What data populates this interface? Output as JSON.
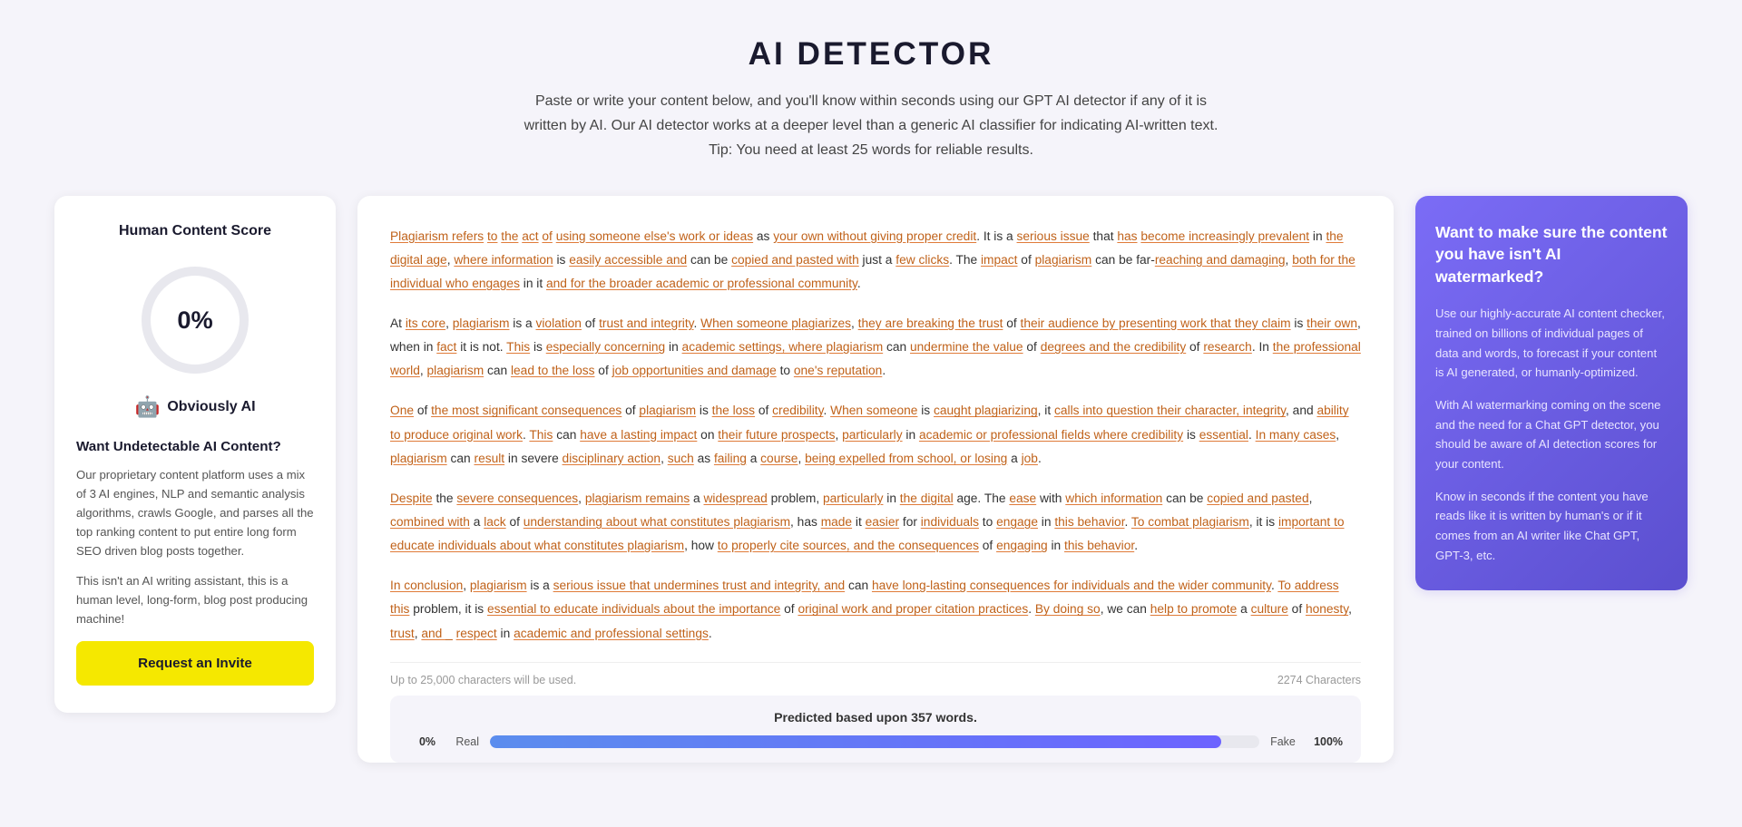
{
  "header": {
    "title": "AI DETECTOR",
    "description": "Paste or write your content below, and you'll know within seconds using our GPT AI detector if any of it is written by AI. Our AI detector works at a deeper level than a generic AI classifier for indicating AI-written text. Tip: You need at least 25 words for reliable results."
  },
  "left_panel": {
    "score_title": "Human Content Score",
    "score_value": "0%",
    "score_label": "Obviously AI",
    "want_title": "Want Undetectable AI Content?",
    "desc1": "Our proprietary content platform uses a mix of 3 AI engines, NLP and semantic analysis algorithms, crawls Google, and parses all the top ranking content to put entire long form SEO driven blog posts together.",
    "desc2": "This isn't an AI writing assistant, this is a human level, long-form, blog post producing machine!",
    "button_label": "Request an Invite"
  },
  "center_panel": {
    "paragraph1": "Plagiarism refers to the act of using someone else's work or ideas as your own without giving proper credit. It is a serious issue that has become increasingly prevalent in the digital age, where information is easily accessible and can be copied and pasted with just a few clicks. The impact of plagiarism can be far-reaching and damaging, both for the individual who engages in it and for the broader academic or professional community.",
    "paragraph2": "At its core, plagiarism is a violation of trust and integrity. When someone plagiarizes, they are breaking the trust of their audience by presenting work that they claim is their own, when in fact it is not. This is especially concerning in academic settings, where plagiarism can undermine the value of degrees and the credibility of research. In the professional world, plagiarism can lead to the loss of job opportunities and damage to one's reputation.",
    "paragraph3": "One of the most significant consequences of plagiarism is the loss of credibility. When someone is caught plagiarizing, it calls into question their character, integrity, and ability to produce original work. This can have a lasting impact on their future prospects, particularly in academic or professional fields where credibility is essential. In many cases, plagiarism can result in severe disciplinary action, such as failing a course, being expelled from school, or losing a job.",
    "paragraph4": "Despite the severe consequences, plagiarism remains a widespread problem, particularly in the digital age. The ease with which information can be copied and pasted, combined with a lack of understanding about what constitutes plagiarism, has made it easier for individuals to engage in this behavior. To combat plagiarism, it is important to educate individuals about what constitutes plagiarism, how to properly cite sources, and the consequences of engaging in this behavior.",
    "paragraph5": "In conclusion, plagiarism is a serious issue that undermines trust and integrity, and can have long-lasting consequences for individuals and the wider community. To address this problem, it is essential to educate individuals about the importance of original work and proper citation practices. By doing so, we can help to promote a culture of honesty, trust, and respect in academic and professional settings.",
    "footer_left": "Up to 25,000 characters will be used.",
    "footer_right": "2274 Characters",
    "prediction_label": "Predicted based upon",
    "prediction_words": "357 words",
    "bar_left_pct": "0%",
    "bar_left_label": "Real",
    "bar_right_pct": "100%",
    "bar_right_label": "Fake"
  },
  "right_panel": {
    "watermark_title": "Want to make sure the content you have isn't AI watermarked?",
    "watermark_p1": "Use our highly-accurate AI content checker, trained on billions of individual pages of data and words, to forecast if your content is AI generated, or humanly-optimized.",
    "watermark_p2": "With AI watermarking coming on the scene and the need for a Chat GPT detector, you should be aware of AI detection scores for your content.",
    "watermark_p3": "Know in seconds if the content you have reads like it is written by human's or if it comes from an AI writer like Chat GPT, GPT-3, etc."
  }
}
